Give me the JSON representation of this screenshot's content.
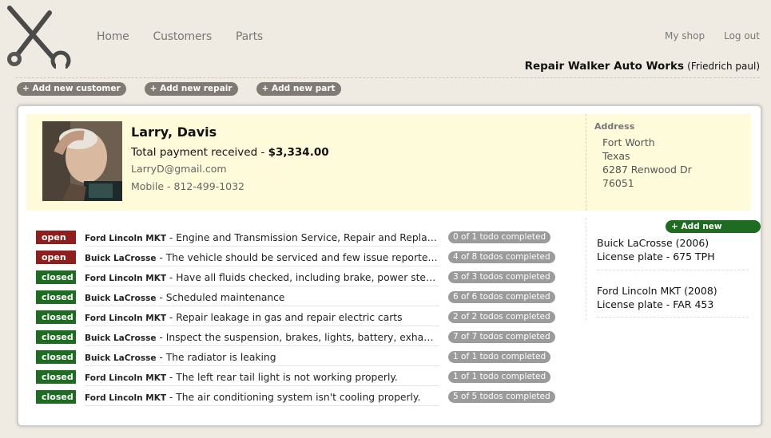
{
  "nav": {
    "items": [
      "Home",
      "Customers",
      "Parts"
    ],
    "right": [
      "My shop",
      "Log out"
    ]
  },
  "shop": {
    "name": "Repair Walker Auto Works",
    "user": "(Friedrich paul)"
  },
  "actions": [
    "+ Add new customer",
    "+ Add new repair",
    "+ Add new part"
  ],
  "customer": {
    "name": "Larry, Davis",
    "payment_label": "Total payment received - ",
    "payment_value": "$3,334.00",
    "email": "LarryD@gmail.com",
    "mobile": "Mobile - 812-499-1032",
    "address_label": "Address",
    "address": [
      "Fort Worth",
      "Texas",
      "6287 Renwood Dr",
      "76051"
    ]
  },
  "repairs": [
    {
      "status": "open",
      "vehicle": "Ford Lincoln MKT",
      "text": " - Engine and Transmission Service, Repair and Replacement",
      "todo": "0 of 1 todo completed"
    },
    {
      "status": "open",
      "vehicle": "Buick LaCrosse",
      "text": " - The vehicle should be serviced and few issue reported were, ...",
      "todo": "4 of 8 todos completed"
    },
    {
      "status": "closed",
      "vehicle": "Ford Lincoln MKT",
      "text": " - Have all fluids checked, including brake, power steering, tran...",
      "todo": "3 of 3 todos completed"
    },
    {
      "status": "closed",
      "vehicle": "Buick LaCrosse",
      "text": " - Scheduled maintenance",
      "todo": "6 of 6 todos completed"
    },
    {
      "status": "closed",
      "vehicle": "Ford Lincoln MKT",
      "text": " - Repair leakage in gas and repair electric carts",
      "todo": "2 of 2 todos completed"
    },
    {
      "status": "closed",
      "vehicle": "Buick LaCrosse",
      "text": " - Inspect the suspension, brakes, lights, battery, exhaust syste...",
      "todo": "7 of 7 todos completed"
    },
    {
      "status": "closed",
      "vehicle": "Buick LaCrosse",
      "text": " - The radiator is leaking",
      "todo": "1 of 1 todo completed"
    },
    {
      "status": "closed",
      "vehicle": "Ford Lincoln MKT",
      "text": " - The left rear tail light is not working properly.",
      "todo": "1 of 1 todo completed"
    },
    {
      "status": "closed",
      "vehicle": "Ford Lincoln MKT",
      "text": " - The air conditioning system isn't cooling properly.",
      "todo": "5 of 5 todos completed"
    }
  ],
  "vehicles": {
    "add_label": "+ Add new vehicle",
    "items": [
      {
        "name": "Buick LaCrosse (2006)",
        "plate": "License plate - 675 TPH"
      },
      {
        "name": "Ford Lincoln MKT (2008)",
        "plate": "License plate - FAR 453"
      }
    ]
  },
  "colors": {
    "open": "#8f1f1c",
    "closed": "#1e6b22",
    "info_bg": "#fdfbd9",
    "pill": "#7f7a73"
  },
  "icons": {
    "logo": "wrench-logo-icon"
  }
}
